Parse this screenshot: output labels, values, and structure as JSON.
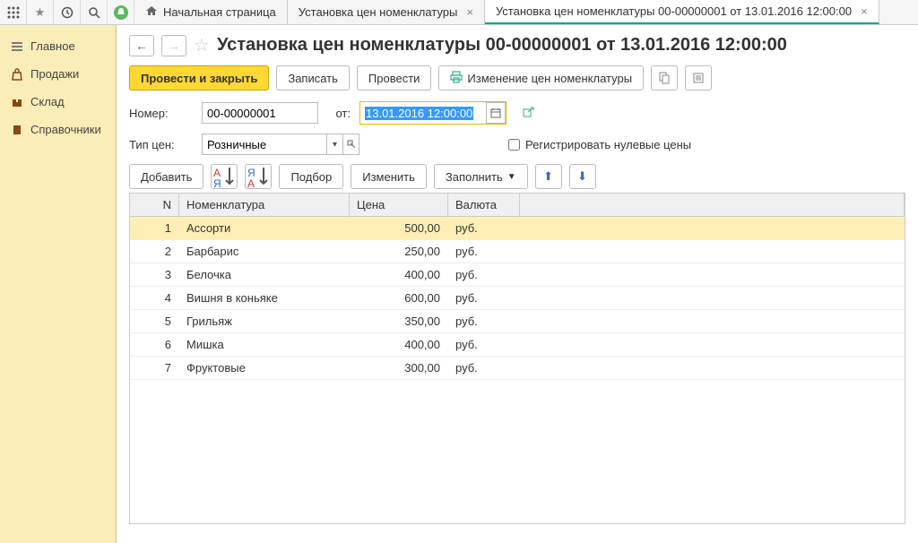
{
  "tabs": {
    "home": "Начальная страница",
    "t1": "Установка цен номенклатуры",
    "t2": "Установка цен номенклатуры 00-00000001 от 13.01.2016 12:00:00"
  },
  "sidebar": {
    "main": "Главное",
    "sales": "Продажи",
    "stock": "Склад",
    "refs": "Справочники"
  },
  "title": "Установка цен номенклатуры 00-00000001 от 13.01.2016 12:00:00",
  "buttons": {
    "post_close": "Провести и закрыть",
    "save": "Записать",
    "post": "Провести",
    "change_prices": "Изменение цен номенклатуры",
    "add": "Добавить",
    "pick": "Подбор",
    "edit": "Изменить",
    "fill": "Заполнить"
  },
  "form": {
    "number_label": "Номер:",
    "number": "00-00000001",
    "from_label": "от:",
    "date": "13.01.2016 12:00:00",
    "price_type_label": "Тип цен:",
    "price_type": "Розничные",
    "zero_prices": "Регистрировать нулевые цены"
  },
  "columns": {
    "n": "N",
    "item": "Номенклатура",
    "price": "Цена",
    "currency": "Валюта"
  },
  "rows": [
    {
      "n": "1",
      "name": "Ассорти",
      "price": "500,00",
      "cur": "руб."
    },
    {
      "n": "2",
      "name": "Барбарис",
      "price": "250,00",
      "cur": "руб."
    },
    {
      "n": "3",
      "name": "Белочка",
      "price": "400,00",
      "cur": "руб."
    },
    {
      "n": "4",
      "name": "Вишня в коньяке",
      "price": "600,00",
      "cur": "руб."
    },
    {
      "n": "5",
      "name": "Грильяж",
      "price": "350,00",
      "cur": "руб."
    },
    {
      "n": "6",
      "name": "Мишка",
      "price": "400,00",
      "cur": "руб."
    },
    {
      "n": "7",
      "name": "Фруктовые",
      "price": "300,00",
      "cur": "руб."
    }
  ]
}
